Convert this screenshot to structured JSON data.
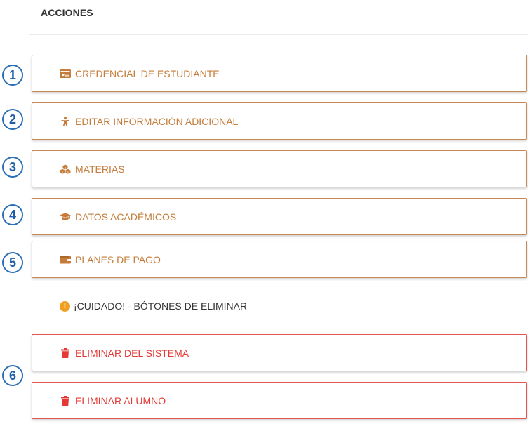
{
  "section": {
    "title": "ACCIONES"
  },
  "actions": [
    {
      "label": "CREDENCIAL DE ESTUDIANTE",
      "icon": "id-card-icon"
    },
    {
      "label": "EDITAR INFORMACIÓN ADICIONAL",
      "icon": "child-icon"
    },
    {
      "label": "MATERIAS",
      "icon": "cubes-icon"
    },
    {
      "label": "DATOS ACADÉMICOS",
      "icon": "graduation-cap-icon"
    },
    {
      "label": "PLANES DE PAGO",
      "icon": "wallet-icon"
    }
  ],
  "warning": {
    "text": "¡CUIDADO! - BÓTONES DE ELIMINAR",
    "icon": "exclamation-circle-icon"
  },
  "danger_actions": [
    {
      "label": "ELIMINAR DEL SISTEMA",
      "icon": "trash-icon"
    },
    {
      "label": "ELIMINAR ALUMNO",
      "icon": "trash-icon"
    }
  ],
  "callouts": [
    "1",
    "2",
    "3",
    "4",
    "5",
    "6"
  ],
  "colors": {
    "accent": "#c57c3a",
    "danger": "#e53935",
    "callout": "#1f5fa8",
    "warning": "#f0a020"
  }
}
